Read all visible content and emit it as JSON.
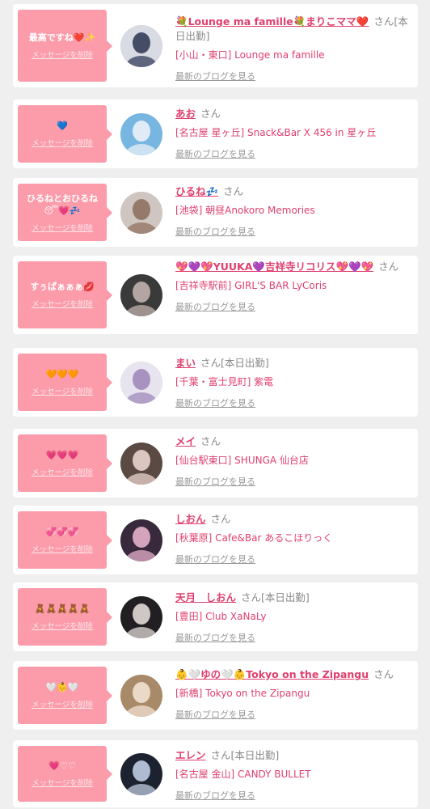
{
  "labels": {
    "delete": "メッセージを削除",
    "san": "さん",
    "blog": "最新のブログを見る"
  },
  "items": [
    {
      "message": "最高ですね❤️✨",
      "name": "💐Lounge ma famille💐まりこママ❤️",
      "status": "[本日出勤]",
      "shop": "[小山・東口] Lounge ma famille",
      "avatar_colors": [
        "#d8dbe3",
        "#2b3350"
      ]
    },
    {
      "message": "💙",
      "name": "あお",
      "status": "",
      "shop": "[名古屋 星ヶ丘] Snack&Bar X 456 in 星ヶ丘",
      "avatar_colors": [
        "#77b6e0",
        "#f1f5f9"
      ]
    },
    {
      "message": "ひるねとおひるね😴💗💤",
      "name": "ひるね💤",
      "status": "",
      "shop": "[池袋] 朝昼Anokoro Memories",
      "avatar_colors": [
        "#cfc6c1",
        "#8b6c5a"
      ]
    },
    {
      "message": "すぅぱぁぁぁ💋",
      "name": "💖💜💖YUUKA💜吉祥寺リコリス💖💜💖",
      "status": "",
      "shop": "[吉祥寺駅前] GIRL'S BAR LyCoris",
      "avatar_colors": [
        "#3a3a3a",
        "#c9b9b4"
      ]
    },
    {
      "message": "🧡🧡🧡",
      "name": "まい",
      "status": "[本日出勤]",
      "shop": "[千葉・富士見町] 紫電",
      "avatar_colors": [
        "#e8e4ef",
        "#9b84b7"
      ]
    },
    {
      "message": "💗💗💗",
      "name": "メイ",
      "status": "",
      "shop": "[仙台駅東口] SHUNGA 仙台店",
      "avatar_colors": [
        "#5b4a44",
        "#f3ddd6"
      ]
    },
    {
      "message": "💞💞💞",
      "name": "しおん",
      "status": "",
      "shop": "[秋葉原] Cafe&Bar あるこほりっく",
      "avatar_colors": [
        "#382a3c",
        "#f0b8d2"
      ]
    },
    {
      "message": "🧸🧸🧸🧸🧸",
      "name": "天月　しおん",
      "status": "[本日出勤]",
      "shop": "[豊田] Club XaNaLy",
      "avatar_colors": [
        "#221f22",
        "#ece5e1"
      ]
    },
    {
      "message": "🤍👶🤍",
      "name": "👶🤍ゆの🤍👶Tokyo on the Zipangu",
      "status": "",
      "shop": "[新橋] Tokyo on the Zipangu",
      "avatar_colors": [
        "#a98a68",
        "#f6e6d8"
      ]
    },
    {
      "message": "💗♡♡",
      "name": "エレン",
      "status": "[本日出勤]",
      "shop": "[名古屋 金山] CANDY BULLET",
      "avatar_colors": [
        "#1d2230",
        "#c9d6ec"
      ]
    }
  ]
}
